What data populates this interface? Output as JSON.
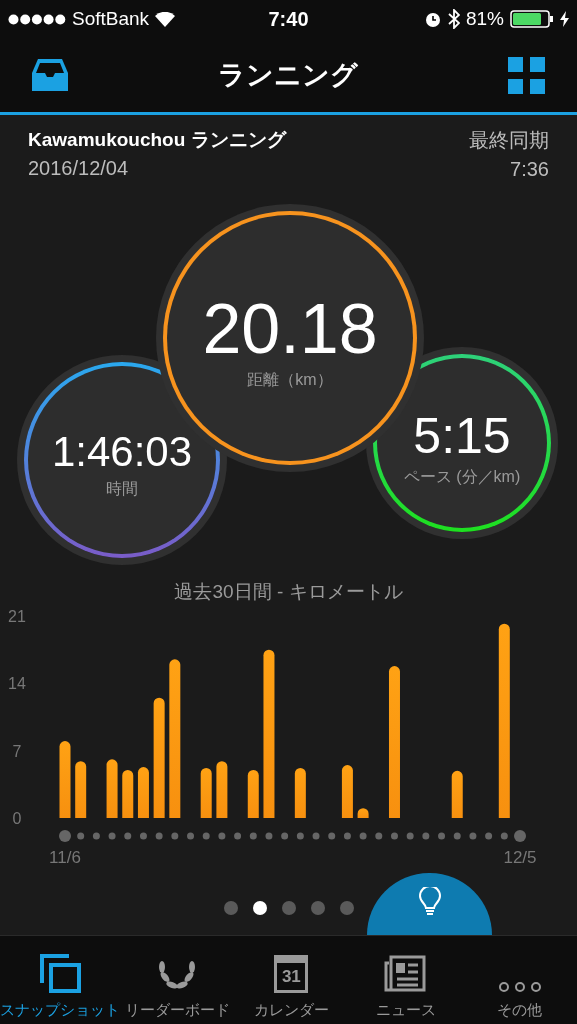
{
  "status_bar": {
    "carrier": "SoftBank",
    "time": "7:40",
    "battery": "81%"
  },
  "header": {
    "title": "ランニング"
  },
  "activity": {
    "name": "Kawamukouchou ランニング",
    "date": "2016/12/04",
    "sync_label": "最終同期",
    "sync_time": "7:36"
  },
  "metrics": [
    {
      "kind": "distance",
      "value": "20.18",
      "label": "距離（km）"
    },
    {
      "kind": "time",
      "value": "1:46:03",
      "label": "時間"
    },
    {
      "kind": "pace",
      "value": "5:15",
      "label": "ペース (分／km)"
    }
  ],
  "chart": {
    "chart_data": {
      "type": "bar",
      "title": "過去30日間 - キロメートル",
      "categories": [
        "11/6",
        null,
        null,
        null,
        null,
        null,
        null,
        null,
        null,
        null,
        null,
        null,
        null,
        null,
        null,
        null,
        null,
        null,
        null,
        null,
        null,
        null,
        null,
        null,
        null,
        null,
        null,
        null,
        null,
        "12/5"
      ],
      "series": [
        {
          "color": "#f7900f",
          "values": [
            8.0,
            5.9,
            0,
            6.1,
            5.0,
            5.3,
            12.5,
            16.5,
            0,
            5.2,
            5.9,
            0,
            5.0,
            17.5,
            0,
            5.2,
            0,
            0,
            5.5,
            0.9,
            0,
            15.8,
            0,
            0,
            0,
            4.9,
            0,
            0,
            20.2,
            0
          ]
        }
      ],
      "ylim": [
        0,
        21
      ],
      "yticks": [
        0,
        7,
        14,
        21
      ]
    }
  },
  "pager": [
    {
      "selected": false
    },
    {
      "selected": true
    },
    {
      "selected": false
    },
    {
      "selected": false
    },
    {
      "selected": false
    }
  ],
  "tabs": [
    {
      "kind": "snapshot",
      "label": "スナップショット",
      "selected": true
    },
    {
      "kind": "leaderboard",
      "label": "リーダーボード",
      "selected": false
    },
    {
      "kind": "calendar",
      "label": "カレンダー",
      "icon_text": "31",
      "selected": false
    },
    {
      "kind": "news",
      "label": "ニュース",
      "selected": false
    },
    {
      "kind": "more",
      "label": "その他",
      "selected": false
    }
  ]
}
